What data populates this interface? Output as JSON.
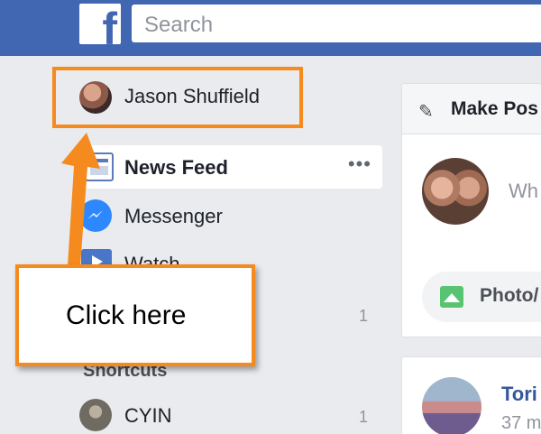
{
  "header": {
    "logo_letter": "f",
    "search_placeholder": "Search"
  },
  "sidebar": {
    "profile_name": "Jason Shuffield",
    "items": [
      {
        "label": "News Feed",
        "icon": "news-feed-icon",
        "more": "•••"
      },
      {
        "label": "Messenger",
        "icon": "messenger-icon"
      },
      {
        "label": "Watch",
        "icon": "watch-icon"
      }
    ],
    "hidden_item_count": "1",
    "shortcuts_title": "Shortcuts",
    "shortcuts": [
      {
        "label": "CYIN",
        "count": "1"
      }
    ]
  },
  "composer": {
    "title": "Make Pos",
    "placeholder_fragment": "Wh",
    "photo_label": "Photo/"
  },
  "feed": {
    "post_author_fragment": "Tori",
    "post_time_fragment": "37 m"
  },
  "annotation": {
    "callout_text": "Click here",
    "accent_color": "#f58a1f"
  }
}
